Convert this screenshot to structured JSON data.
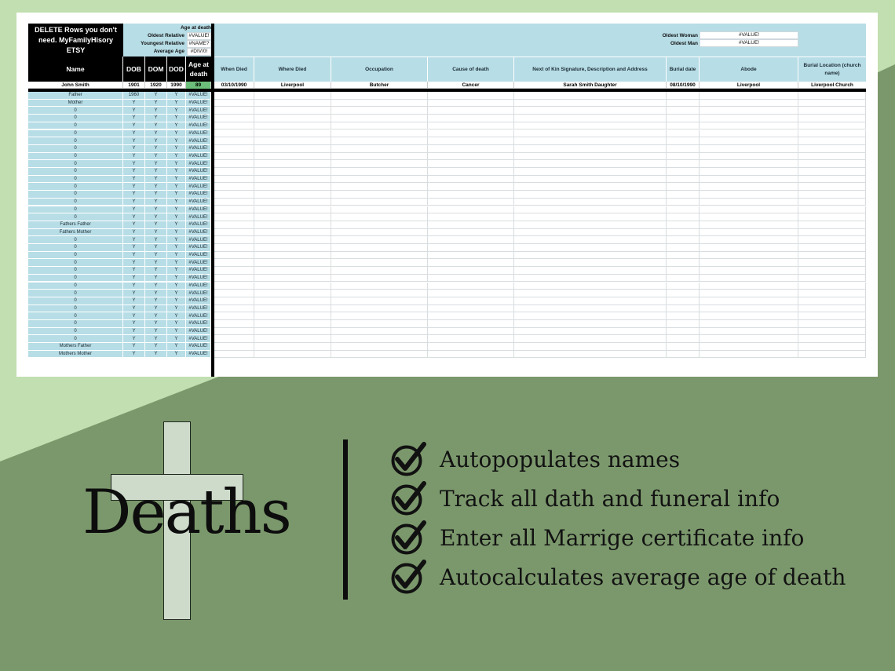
{
  "sheet": {
    "title_box": "DELETE Rows you don't need. MyFamilyHisory ETSY",
    "summary": {
      "header": "Age at death",
      "rows": [
        {
          "label": "Oldest Relative",
          "value": "#VALUE!"
        },
        {
          "label": "Youngest Relative",
          "value": "#NAME?"
        },
        {
          "label": "Average Age",
          "value": "#DIV/0!"
        }
      ],
      "oldest_woman_label": "Oldest Woman",
      "oldest_woman_value": "#VALUE!",
      "oldest_man_label": "Oldest Man",
      "oldest_man_value": "#VALUE!"
    },
    "left_headers": [
      "Name",
      "DOB",
      "DOM",
      "DOD",
      "Age at death"
    ],
    "right_headers": [
      "When Died",
      "Where Died",
      "Occupation",
      "Cause of death",
      "Next of Kin Signature, Description and Address",
      "Burial date",
      "Abode",
      "Burial Location (church name)"
    ],
    "example_row": {
      "name": "John Smith",
      "dob": "1901",
      "dom": "1920",
      "dod": "1990",
      "age": "89",
      "when_died": "03/10/1990",
      "where_died": "Liverpool",
      "occupation": "Butcher",
      "cause": "Cancer",
      "next_of_kin": "Sarah Smith Daughter",
      "burial_date": "08/10/1990",
      "abode": "Liverpool",
      "burial_location": "Liverpool Church"
    },
    "rows": [
      {
        "name": "Father",
        "dob": "1960",
        "dom": "Y",
        "dod": "Y",
        "age": "#VALUE!"
      },
      {
        "name": "Mother",
        "dob": "Y",
        "dom": "Y",
        "dod": "Y",
        "age": "#VALUE!"
      },
      {
        "name": "0",
        "dob": "Y",
        "dom": "Y",
        "dod": "Y",
        "age": "#VALUE!"
      },
      {
        "name": "0",
        "dob": "Y",
        "dom": "Y",
        "dod": "Y",
        "age": "#VALUE!"
      },
      {
        "name": "0",
        "dob": "Y",
        "dom": "Y",
        "dod": "Y",
        "age": "#VALUE!"
      },
      {
        "name": "0",
        "dob": "Y",
        "dom": "Y",
        "dod": "Y",
        "age": "#VALUE!"
      },
      {
        "name": "0",
        "dob": "Y",
        "dom": "Y",
        "dod": "Y",
        "age": "#VALUE!"
      },
      {
        "name": "0",
        "dob": "Y",
        "dom": "Y",
        "dod": "Y",
        "age": "#VALUE!"
      },
      {
        "name": "0",
        "dob": "Y",
        "dom": "Y",
        "dod": "Y",
        "age": "#VALUE!"
      },
      {
        "name": "0",
        "dob": "Y",
        "dom": "Y",
        "dod": "Y",
        "age": "#VALUE!"
      },
      {
        "name": "0",
        "dob": "Y",
        "dom": "Y",
        "dod": "Y",
        "age": "#VALUE!"
      },
      {
        "name": "0",
        "dob": "Y",
        "dom": "Y",
        "dod": "Y",
        "age": "#VALUE!"
      },
      {
        "name": "0",
        "dob": "Y",
        "dom": "Y",
        "dod": "Y",
        "age": "#VALUE!"
      },
      {
        "name": "0",
        "dob": "Y",
        "dom": "Y",
        "dod": "Y",
        "age": "#VALUE!"
      },
      {
        "name": "0",
        "dob": "Y",
        "dom": "Y",
        "dod": "Y",
        "age": "#VALUE!"
      },
      {
        "name": "0",
        "dob": "Y",
        "dom": "Y",
        "dod": "Y",
        "age": "#VALUE!"
      },
      {
        "name": "0",
        "dob": "Y",
        "dom": "Y",
        "dod": "Y",
        "age": "#VALUE!"
      },
      {
        "name": "Fathers Father",
        "dob": "Y",
        "dom": "Y",
        "dod": "Y",
        "age": "#VALUE!"
      },
      {
        "name": "Fathers Mother",
        "dob": "Y",
        "dom": "Y",
        "dod": "Y",
        "age": "#VALUE!"
      },
      {
        "name": "0",
        "dob": "Y",
        "dom": "Y",
        "dod": "Y",
        "age": "#VALUE!"
      },
      {
        "name": "0",
        "dob": "Y",
        "dom": "Y",
        "dod": "Y",
        "age": "#VALUE!"
      },
      {
        "name": "0",
        "dob": "Y",
        "dom": "Y",
        "dod": "Y",
        "age": "#VALUE!"
      },
      {
        "name": "0",
        "dob": "Y",
        "dom": "Y",
        "dod": "Y",
        "age": "#VALUE!"
      },
      {
        "name": "0",
        "dob": "Y",
        "dom": "Y",
        "dod": "Y",
        "age": "#VALUE!"
      },
      {
        "name": "0",
        "dob": "Y",
        "dom": "Y",
        "dod": "Y",
        "age": "#VALUE!"
      },
      {
        "name": "0",
        "dob": "Y",
        "dom": "Y",
        "dod": "Y",
        "age": "#VALUE!"
      },
      {
        "name": "0",
        "dob": "Y",
        "dom": "Y",
        "dod": "Y",
        "age": "#VALUE!"
      },
      {
        "name": "0",
        "dob": "Y",
        "dom": "Y",
        "dod": "Y",
        "age": "#VALUE!"
      },
      {
        "name": "0",
        "dob": "Y",
        "dom": "Y",
        "dod": "Y",
        "age": "#VALUE!"
      },
      {
        "name": "0",
        "dob": "Y",
        "dom": "Y",
        "dod": "Y",
        "age": "#VALUE!"
      },
      {
        "name": "0",
        "dob": "Y",
        "dom": "Y",
        "dod": "Y",
        "age": "#VALUE!"
      },
      {
        "name": "0",
        "dob": "Y",
        "dom": "Y",
        "dod": "Y",
        "age": "#VALUE!"
      },
      {
        "name": "0",
        "dob": "Y",
        "dom": "Y",
        "dod": "Y",
        "age": "#VALUE!"
      },
      {
        "name": "Mothers Father",
        "dob": "Y",
        "dom": "Y",
        "dod": "Y",
        "age": "#VALUE!"
      },
      {
        "name": "Mothers Mother",
        "dob": "Y",
        "dom": "Y",
        "dod": "Y",
        "age": "#VALUE!"
      }
    ]
  },
  "banner": {
    "title": "Deaths",
    "features": [
      "Autopopulates names",
      "Track all dath and funeral info",
      "Enter all Marrige certificate info",
      "Autocalculates average age of death"
    ]
  },
  "colors": {
    "sheet_blue": "#b7dde6",
    "age_green": "#6cbf7a",
    "background_green": "#7b986c",
    "background_light": "#c1dfb0",
    "cross_fill": "#cedbcb"
  },
  "icons": {
    "feature_bullet": "checkmark-circle-icon",
    "banner_graphic": "cross-icon"
  }
}
